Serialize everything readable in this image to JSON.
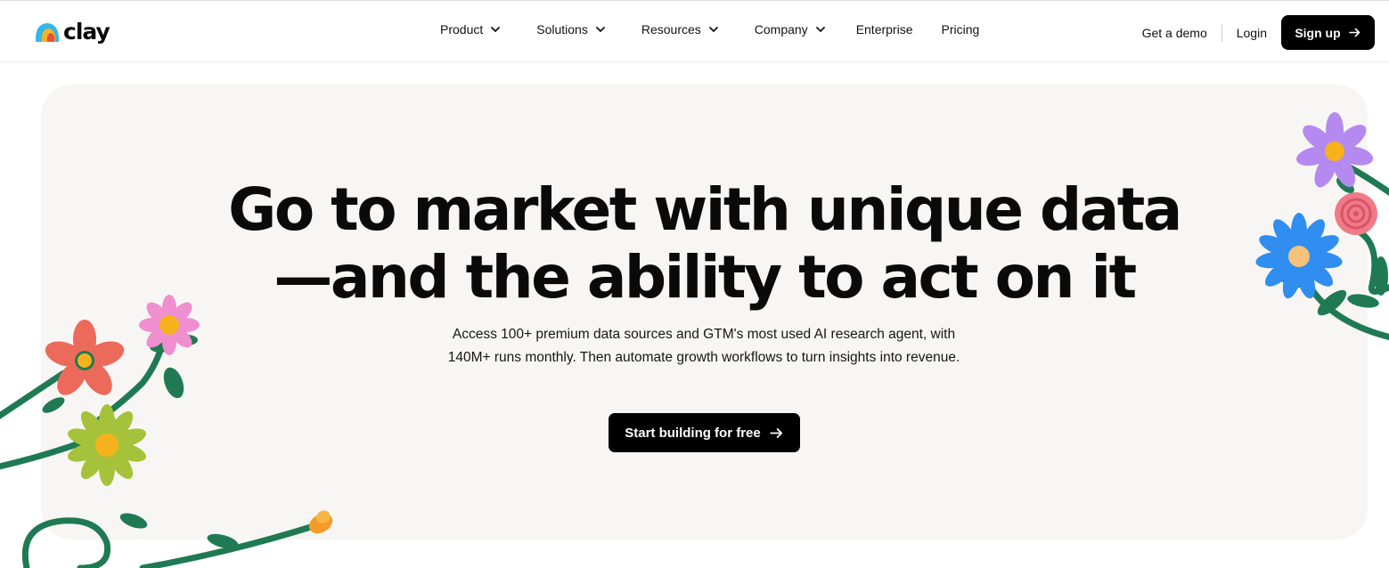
{
  "brand": {
    "name": "clay"
  },
  "nav": {
    "menu": [
      {
        "label": "Product",
        "has_dropdown": true
      },
      {
        "label": "Solutions",
        "has_dropdown": true
      },
      {
        "label": "Resources",
        "has_dropdown": true
      },
      {
        "label": "Company",
        "has_dropdown": true
      },
      {
        "label": "Enterprise",
        "has_dropdown": false
      },
      {
        "label": "Pricing",
        "has_dropdown": false
      }
    ],
    "get_demo": "Get a demo",
    "login": "Login",
    "signup": "Sign up"
  },
  "hero": {
    "headline_line1": "Go to market with unique data",
    "headline_line2": "—and the ability to act on it",
    "subtext": "Access 100+ premium data sources and GTM's most used AI research agent, with 140M+ runs monthly. Then automate growth workflows to turn insights into revenue.",
    "cta": "Start building for free"
  },
  "colors": {
    "hero_bg": "#f8f6f4",
    "button_bg": "#000000",
    "stem_green": "#1f7a54",
    "flower_pink": "#f08fcf",
    "flower_coral": "#ec6a5a",
    "flower_olive": "#a6c23a",
    "flower_purple": "#b58af0",
    "flower_blue": "#2f8ef0",
    "flower_rose": "#f07a86",
    "flower_orange": "#f59b2a",
    "center_yellow": "#f6b21c"
  }
}
